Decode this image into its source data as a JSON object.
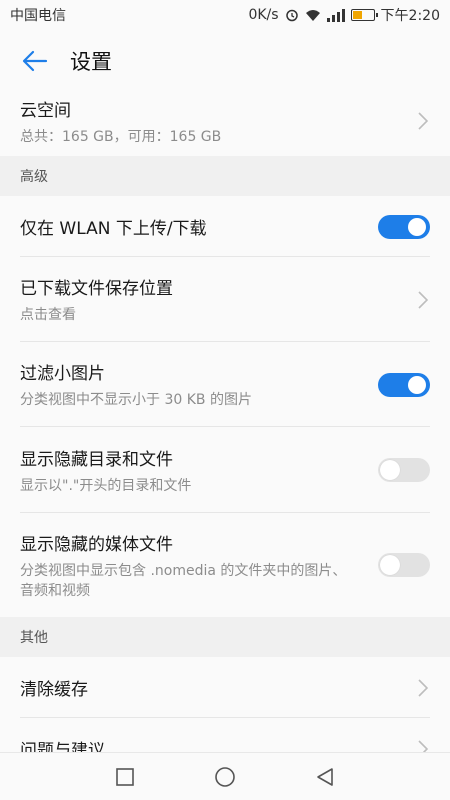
{
  "statusbar": {
    "carrier": "中国电信",
    "speed": "0K/s",
    "network": "36 26",
    "time": "下午2:20",
    "battery_level": 0.45
  },
  "appbar": {
    "title": "设置"
  },
  "cloud": {
    "title": "云空间",
    "sub": "总共：165 GB，可用：165 GB"
  },
  "sections": {
    "advanced": "高级",
    "other": "其他"
  },
  "settings": {
    "wlan_only": {
      "title": "仅在 WLAN 下上传/下载",
      "on": true
    },
    "download_location": {
      "title": "已下载文件保存位置",
      "sub": "点击查看"
    },
    "filter_small": {
      "title": "过滤小图片",
      "sub": "分类视图中不显示小于 30 KB 的图片",
      "on": true
    },
    "show_hidden": {
      "title": "显示隐藏目录和文件",
      "sub": "显示以\".\"开头的目录和文件",
      "on": false
    },
    "show_hidden_media": {
      "title": "显示隐藏的媒体文件",
      "sub": "分类视图中显示包含 .nomedia 的文件夹中的图片、音频和视频",
      "on": false
    },
    "clear_cache": {
      "title": "清除缓存"
    },
    "feedback": {
      "title": "问题与建议"
    }
  },
  "colors": {
    "accent": "#1e7ee8",
    "toggle_off": "#e2e2e2"
  }
}
